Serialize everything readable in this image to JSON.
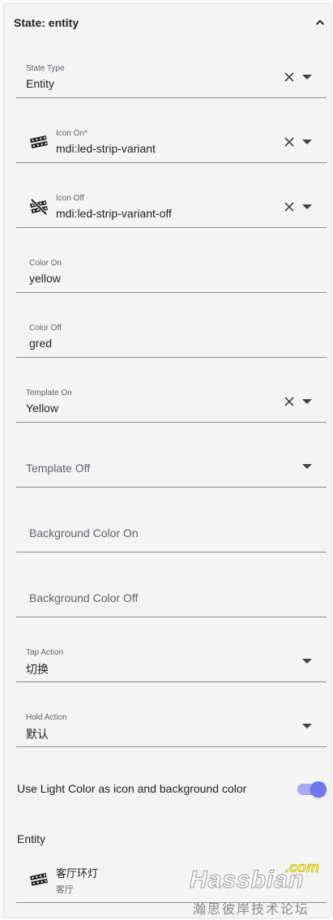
{
  "section": {
    "title": "State: entity"
  },
  "fields": {
    "state_type": {
      "label": "State Type",
      "value": "Entity"
    },
    "icon_on": {
      "label": "Icon On*",
      "value": "mdi:led-strip-variant",
      "icon": "led-strip-variant-icon"
    },
    "icon_off": {
      "label": "Icon Off",
      "value": "mdi:led-strip-variant-off",
      "icon": "led-strip-variant-off-icon"
    },
    "color_on": {
      "label": "Color On",
      "value": "yellow"
    },
    "color_off": {
      "label": "Color Off",
      "value": "gred"
    },
    "template_on": {
      "label": "Template On",
      "value": "Yellow"
    },
    "template_off": {
      "placeholder": "Template Off"
    },
    "background_color_on": {
      "placeholder": "Background Color On"
    },
    "background_color_off": {
      "placeholder": "Background Color Off"
    },
    "tap_action": {
      "label": "Tap Action",
      "value": "切换"
    },
    "hold_action": {
      "label": "Hold Action",
      "value": "默认"
    }
  },
  "toggle": {
    "label": "Use Light Color as icon and background color",
    "checked": true
  },
  "entity": {
    "heading": "Entity",
    "name": "客厅环灯",
    "area": "客厅",
    "icon": "led-strip-variant-icon"
  },
  "watermark": {
    "main": "Hassbian",
    "suffix": ".com",
    "subtitle": "瀚思彼岸技术论坛"
  },
  "colors": {
    "accent": "#6f75ee",
    "toggle_track": "#a7a9f2",
    "divider": "#8c8c8c",
    "card_bg": "#f4f4f5"
  }
}
